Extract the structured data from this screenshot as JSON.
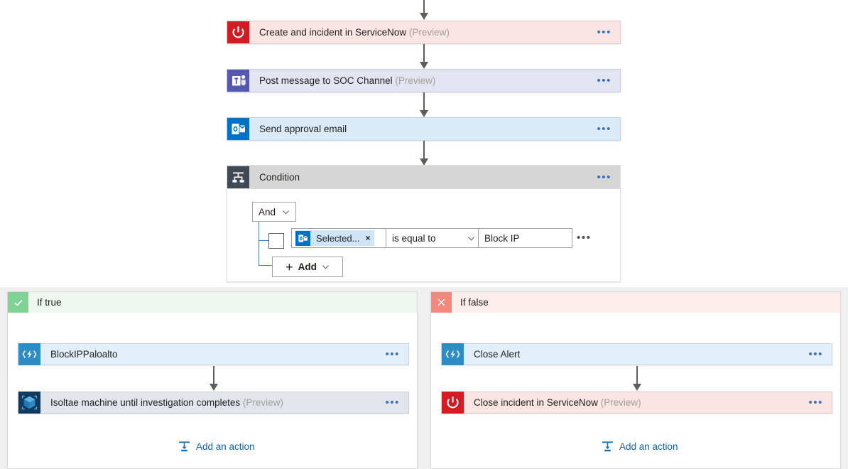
{
  "colors": {
    "servicenow_red": "#d31b23",
    "teams_purple": "#5558af",
    "outlook_blue": "#0072c6",
    "function_blue": "#2e8bc4",
    "defender_navy": "#123a5e",
    "condition_slate": "#3f4a54",
    "true_green": "#7ed294",
    "false_salmon": "#f4887c",
    "link_blue": "#0f62ac",
    "canvas_gray": "#f0f0f0"
  },
  "flow": {
    "cards": [
      {
        "id": "create-incident-servicenow",
        "icon": "servicenow-power-icon",
        "title": "Create and incident in ServiceNow",
        "preview": "(Preview)",
        "overflow": "•••"
      },
      {
        "id": "post-message-soc-channel",
        "icon": "microsoft-teams-icon",
        "title": "Post message to SOC Channel",
        "preview": "(Preview)",
        "overflow": "•••"
      },
      {
        "id": "send-approval-email",
        "icon": "outlook-icon",
        "title": "Send approval email",
        "preview": "",
        "overflow": "•••"
      }
    ],
    "condition": {
      "icon": "condition-branch-icon",
      "title": "Condition",
      "overflow": "•••",
      "conjunction": "And",
      "row": {
        "token_icon": "outlook-icon",
        "token_label": "Selected...",
        "token_remove": "×",
        "operator": "is equal to",
        "value": "Block IP",
        "overflow": "•••"
      },
      "add_label": "Add",
      "add_plus": "+"
    },
    "branches": [
      {
        "id": "if-true",
        "label": "If true",
        "badge_icon": "checkmark-icon",
        "cards": [
          {
            "id": "blockippaloalto",
            "icon": "azure-function-icon",
            "title": "BlockIPPaloalto",
            "preview": "",
            "overflow": "•••"
          },
          {
            "id": "isolate-machine",
            "icon": "defender-cube-icon",
            "title": "Isoltae machine until investigation completes",
            "preview": "(Preview)",
            "overflow": "•••"
          }
        ],
        "add_action_label": "Add an action"
      },
      {
        "id": "if-false",
        "label": "If false",
        "badge_icon": "close-x-icon",
        "cards": [
          {
            "id": "close-alert",
            "icon": "azure-function-icon",
            "title": "Close Alert",
            "preview": "",
            "overflow": "•••"
          },
          {
            "id": "close-incident-servicenow",
            "icon": "servicenow-power-icon",
            "title": "Close incident in ServiceNow",
            "preview": "(Preview)",
            "overflow": "•••"
          }
        ],
        "add_action_label": "Add an action"
      }
    ]
  }
}
